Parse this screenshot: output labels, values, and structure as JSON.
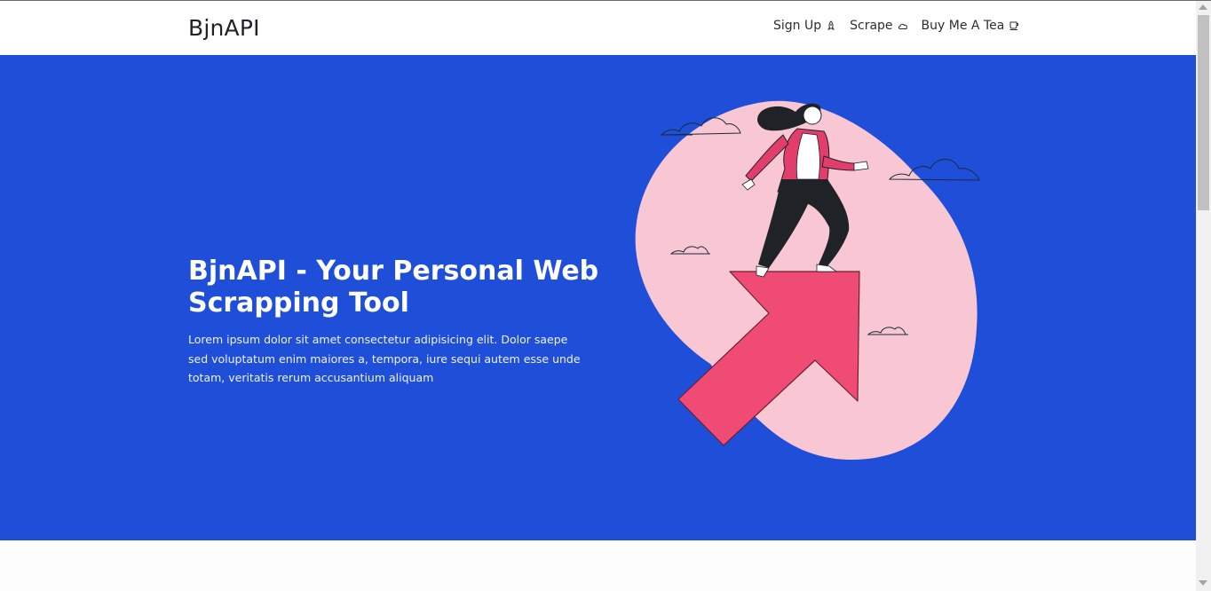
{
  "navbar": {
    "brand": "BjnAPI",
    "links": [
      {
        "label": "Sign Up",
        "icon": "rocket-icon"
      },
      {
        "label": "Scrape",
        "icon": "cloud-icon"
      },
      {
        "label": "Buy Me A Tea",
        "icon": "cup-icon"
      }
    ]
  },
  "hero": {
    "title": "BjnAPI - Your Personal Web Scrapping Tool",
    "text": "Lorem ipsum dolor sit amet consectetur adipisicing elit. Dolor saepe sed voluptatum enim maiores a, tempora, iure sequi autem esse unde totam, veritatis rerum accusantium aliquam",
    "illustration": "woman-climbing-arrow-illustration"
  },
  "colors": {
    "hero_bg": "#1f4fd8",
    "blob": "#f9c7d4",
    "arrow": "#ef4b75"
  }
}
